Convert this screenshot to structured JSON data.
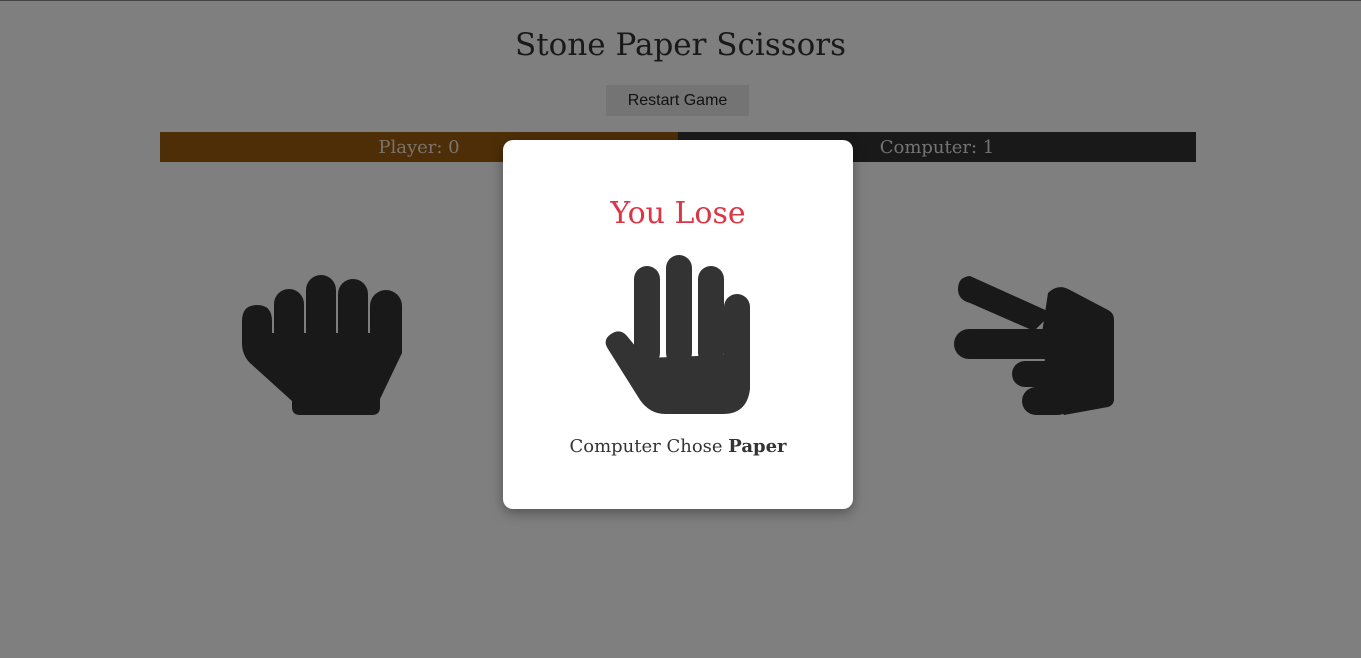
{
  "header": {
    "title": "Stone Paper Scissors",
    "restart_label": "Restart Game"
  },
  "score": {
    "player_label": "Player: 0",
    "computer_label": "Computer: 1"
  },
  "choices": [
    {
      "id": "stone",
      "icon": "hand-rock-icon"
    },
    {
      "id": "paper",
      "icon": "hand-paper-icon"
    },
    {
      "id": "scissors",
      "icon": "hand-scissors-icon"
    }
  ],
  "modal": {
    "result": "You Lose",
    "result_color": "#dc3545",
    "icon": "hand-paper-icon",
    "prefix": "Computer Chose",
    "choice": "Paper"
  },
  "colors": {
    "player_bar": "#9b5c0e",
    "computer_bar": "#333333"
  }
}
